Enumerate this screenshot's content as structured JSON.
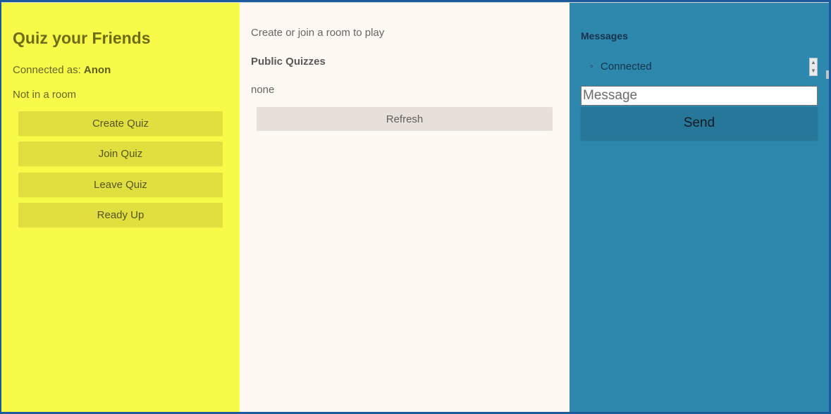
{
  "left": {
    "title": "Quiz your Friends",
    "connected_prefix": "Connected as: ",
    "connected_user": "Anon",
    "room_status": "Not in a room",
    "buttons": {
      "create": "Create Quiz",
      "join": "Join Quiz",
      "leave": "Leave Quiz",
      "ready": "Ready Up"
    }
  },
  "middle": {
    "intro": "Create or join a room to play",
    "public_heading": "Public Quizzes",
    "public_list_empty": "none",
    "refresh_label": "Refresh"
  },
  "right": {
    "heading": "Messages",
    "messages": [
      "Connected"
    ],
    "message_placeholder": "Message",
    "send_label": "Send"
  },
  "colors": {
    "left_bg": "#f8fa4a",
    "middle_bg": "#fef8f2",
    "right_bg": "#2e87ad",
    "frame": "#1c5a9c"
  },
  "icons": {
    "scroll_up": "scroll-up-arrow-icon",
    "scroll_down": "scroll-down-arrow-icon"
  }
}
